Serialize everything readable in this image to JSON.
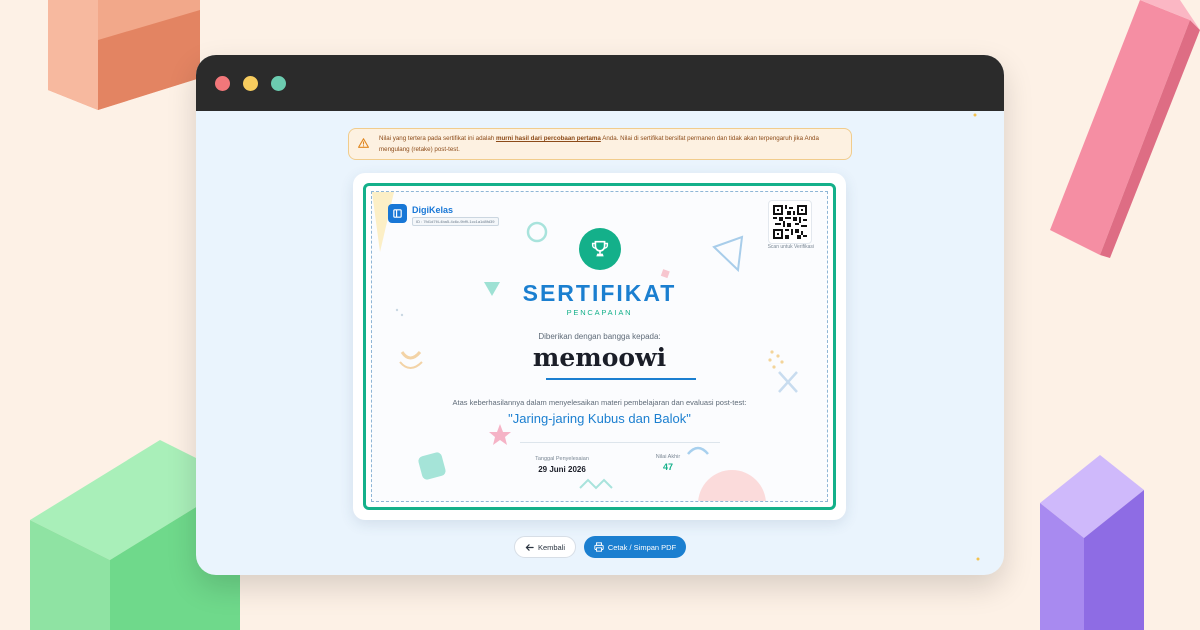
{
  "notice": {
    "part1": "Nilai yang tertera pada sertifikat ini adalah ",
    "emphasis": "murni hasil dari percobaan pertama",
    "part2": " Anda. Nilai di sertifikat bersifat permanen dan tidak akan terpengaruh jika Anda mengulang (retake) post-test.",
    "icon": "warning-icon"
  },
  "certificate": {
    "brand": "DigiKelas",
    "id_text": "ID : 7fd1d7f4-4ba5-4c6c-9bf9-1cc1a1d8fd39",
    "qr_label": "Scan untuk Verifikasi",
    "title": "SERTIFIKAT",
    "subtitle": "PENCAPAIAN",
    "given_text": "Diberikan dengan bangga kepada:",
    "recipient": "memoowi",
    "achievement_text": "Atas keberhasilannya dalam menyelesaikan materi pembelajaran dan evaluasi post-test:",
    "course": "\"Jaring-jaring Kubus dan Balok\"",
    "date_label": "Tanggal Penyelesaian",
    "date_value": "29 Juni 2026",
    "score_label": "Nilai Akhir",
    "score_value": "47",
    "accent": "#14b08a",
    "primary": "#1b7fd0"
  },
  "actions": {
    "back_label": "Kembali",
    "print_label": "Cetak / Simpan PDF"
  }
}
